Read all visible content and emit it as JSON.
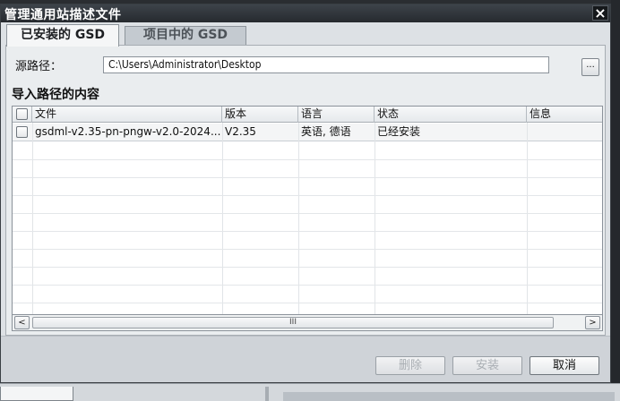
{
  "dialog": {
    "title": "管理通用站描述文件",
    "close_glyph": "×"
  },
  "tabs": [
    {
      "label": "已安装的 GSD",
      "active": true
    },
    {
      "label": "项目中的 GSD",
      "active": false
    }
  ],
  "source": {
    "label": "源路径：",
    "path": "C:\\Users\\Administrator\\Desktop",
    "browse_label": "..."
  },
  "content": {
    "section_title": "导入路径的内容",
    "columns": [
      "文件",
      "版本",
      "语言",
      "状态",
      "信息"
    ],
    "rows": [
      {
        "file": "gsdml-v2.35-pn-pngw-v2.0-2024...",
        "version": "V2.35",
        "language": "英语, 德语",
        "status": "已经安装",
        "info": ""
      }
    ]
  },
  "scrollbar": {
    "left_glyph": "<",
    "right_glyph": ">",
    "thumb_grip": "III"
  },
  "buttons": {
    "delete": "删除",
    "install": "安装",
    "cancel": "取消"
  },
  "colors": {
    "titlebar": "#2b2f34",
    "disabled_text": "#a9aeb3"
  }
}
